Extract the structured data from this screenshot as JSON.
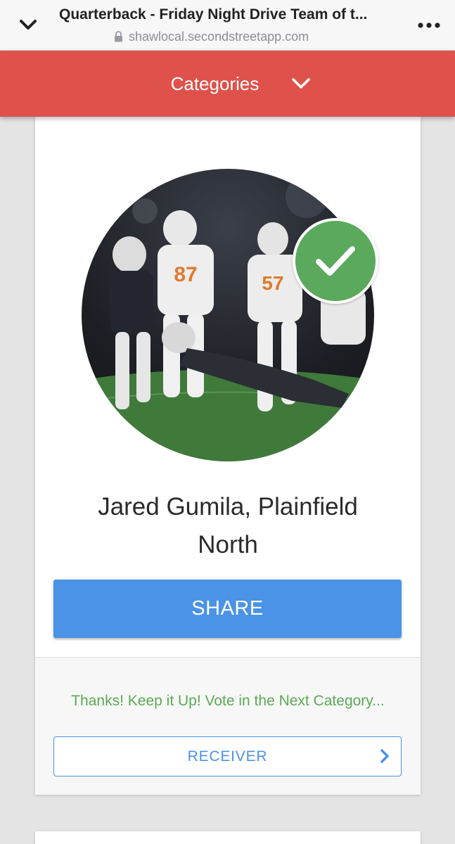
{
  "browser": {
    "title": "Quarterback - Friday Night Drive Team of t...",
    "url": "shawlocal.secondstreetapp.com"
  },
  "header": {
    "categories_label": "Categories"
  },
  "card": {
    "name_line1": "Jared Gumila, Plainfield",
    "name_line2": "North",
    "share_label": "SHARE",
    "thanks_text": "Thanks! Keep it Up! Vote in the Next Category...",
    "next_category_label": "RECEIVER"
  },
  "icons": {
    "collapse": "chevron-down-icon",
    "lock": "lock-icon",
    "more": "more-icon",
    "categories_toggle": "chevron-down-icon",
    "voted": "checkmark-icon",
    "next": "chevron-right-icon"
  },
  "colors": {
    "header_bg": "#de524b",
    "share_bg": "#4a93e6",
    "thanks_text": "#5aaa55",
    "check_bg": "#5aa95c"
  }
}
